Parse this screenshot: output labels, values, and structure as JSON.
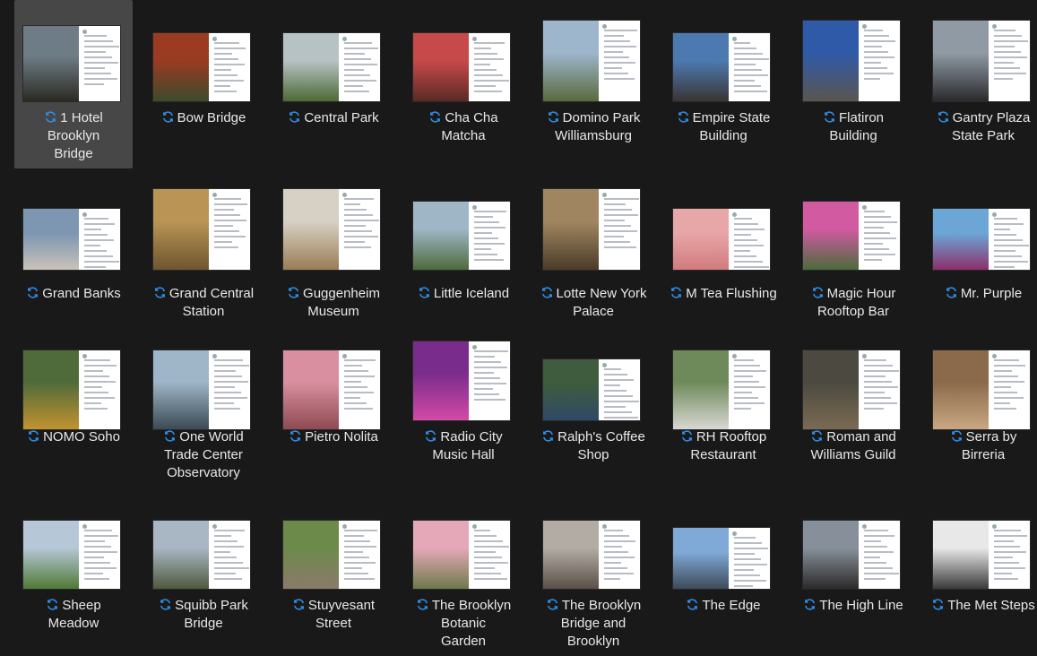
{
  "window": {
    "view": "file-explorer-large-icons"
  },
  "accent": "#2e8fea",
  "files": [
    {
      "name": "1 Hotel\nBrooklyn\nBridge",
      "selected": true,
      "c1": "#6e7c86",
      "c2": "#2b2a22"
    },
    {
      "name": "Bow Bridge",
      "c1": "#9a3b22",
      "c2": "#3d4a2b"
    },
    {
      "name": "Central Park",
      "c1": "#b7c2c4",
      "c2": "#4d6a35"
    },
    {
      "name": "Cha Cha\nMatcha",
      "c1": "#c64a4a",
      "c2": "#5a2a25"
    },
    {
      "name": "Domino Park\nWilliamsburg",
      "c1": "#9db6cc",
      "c2": "#596a3c"
    },
    {
      "name": "Empire State\nBuilding",
      "c1": "#4c7ab0",
      "c2": "#3a3432"
    },
    {
      "name": "Flatiron\nBuilding",
      "c1": "#2f5aa8",
      "c2": "#5a5650"
    },
    {
      "name": "Gantry Plaza\nState Park",
      "c1": "#8f9aa4",
      "c2": "#2a2a2c"
    },
    {
      "name": "Grand Banks",
      "c1": "#7d96b2",
      "c2": "#c9c2b8"
    },
    {
      "name": "Grand Central\nStation",
      "c1": "#b99455",
      "c2": "#6e5630"
    },
    {
      "name": "Guggenheim\nMuseum",
      "c1": "#d7d1c5",
      "c2": "#9a7c55"
    },
    {
      "name": "Little Iceland",
      "c1": "#9fb6c6",
      "c2": "#4e6b3d"
    },
    {
      "name": "Lotte New York\nPalace",
      "c1": "#a08660",
      "c2": "#4b3c2a"
    },
    {
      "name": "M Tea Flushing",
      "c1": "#e7a6a7",
      "c2": "#d27b7e"
    },
    {
      "name": "Magic Hour\nRooftop Bar",
      "c1": "#d25aa0",
      "c2": "#4b6b3d"
    },
    {
      "name": "Mr. Purple",
      "c1": "#6ba6d6",
      "c2": "#8c2f6a"
    },
    {
      "name": "NOMO Soho",
      "c1": "#4f6b3a",
      "c2": "#c29330"
    },
    {
      "name": "One World\nTrade Center\nObservatory",
      "c1": "#9eb6c8",
      "c2": "#3b4a55"
    },
    {
      "name": "Pietro Nolita",
      "c1": "#d98fa0",
      "c2": "#8e4a52"
    },
    {
      "name": "Radio City\nMusic Hall",
      "c1": "#7a2c8c",
      "c2": "#d24aa6"
    },
    {
      "name": "Ralph's Coffee\nShop",
      "c1": "#3f5c3e",
      "c2": "#2f4966"
    },
    {
      "name": "RH Rooftop\nRestaurant",
      "c1": "#6e8a5a",
      "c2": "#d8d8d2"
    },
    {
      "name": "Roman and\nWilliams Guild",
      "c1": "#4c4a40",
      "c2": "#7a6a52"
    },
    {
      "name": "Serra by\nBirreria",
      "c1": "#8a6a4a",
      "c2": "#c9a782"
    },
    {
      "name": "Sheep\nMeadow",
      "c1": "#b6c7d8",
      "c2": "#4f7a34"
    },
    {
      "name": "Squibb Park\nBridge",
      "c1": "#a9b6c4",
      "c2": "#4e5a3c"
    },
    {
      "name": "Stuyvesant\nStreet",
      "c1": "#6c8a4a",
      "c2": "#8a7a6a"
    },
    {
      "name": "The Brooklyn\nBotanic\nGarden",
      "c1": "#e5a8b8",
      "c2": "#6d7a4a"
    },
    {
      "name": "The Brooklyn\nBridge and\nBrooklyn",
      "c1": "#b2aca4",
      "c2": "#5a5048"
    },
    {
      "name": "The Edge",
      "c1": "#7fa9d6",
      "c2": "#3e4a58"
    },
    {
      "name": "The High Line",
      "c1": "#87909a",
      "c2": "#2c2a2a"
    },
    {
      "name": "The Met Steps",
      "c1": "#e8e8e8",
      "c2": "#3a3a3a"
    }
  ]
}
